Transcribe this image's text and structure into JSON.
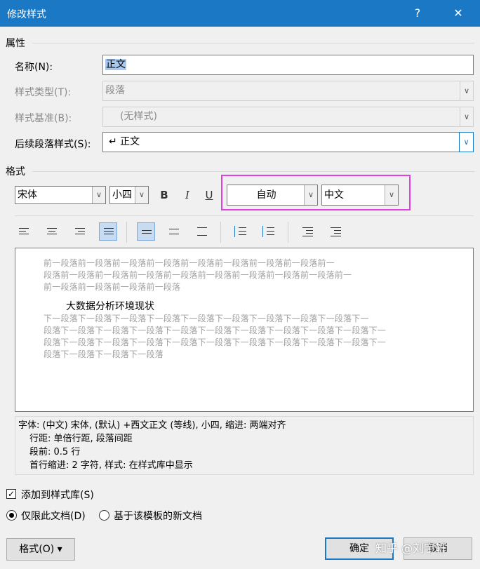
{
  "window": {
    "title": "修改样式",
    "help_glyph": "?",
    "close_glyph": "✕"
  },
  "properties": {
    "section_label": "属性",
    "name_label": "名称(N):",
    "name_value": "正文",
    "style_type_label": "样式类型(T):",
    "style_type_value": "段落",
    "style_based_label": "样式基准(B):",
    "style_based_value": "(无样式)",
    "next_style_label": "后续段落样式(S):",
    "next_style_value": "↵ 正文"
  },
  "format": {
    "section_label": "格式",
    "font": "宋体",
    "size": "小四",
    "bold": "B",
    "italic": "I",
    "underline": "U",
    "color": "自动",
    "language": "中文"
  },
  "preview": {
    "prev_lines": [
      "前一段落前一段落前一段落前一段落前一段落前一段落前一段落前一段落前一",
      "段落前一段落前一段落前一段落前一段落前一段落前一段落前一段落前一段落前一",
      "前一段落前一段落前一段落前一段落"
    ],
    "main_text": "大数据分析环境现状",
    "next_lines": [
      "下一段落下一段落下一段落下一段落下一段落下一段落下一段落下一段落下一段落下一",
      "段落下一段落下一段落下一段落下一段落下一段落下一段落下一段落下一段落下一段落下一",
      "段落下一段落下一段落下一段落下一段落下一段落下一段落下一段落下一段落下一段落下一",
      "段落下一段落下一段落下一段落"
    ]
  },
  "description": {
    "line1": "字体: (中文) 宋体, (默认) +西文正文 (等线), 小四, 缩进: 两端对齐",
    "line2": "行距: 单倍行距, 段落间距",
    "line3": "段前: 0.5 行",
    "line4": "首行缩进: 2 字符, 样式: 在样式库中显示"
  },
  "options": {
    "add_to_gallery": "添加到样式库(S)",
    "add_to_gallery_checked": true,
    "only_this_doc": "仅限此文档(D)",
    "new_docs_template": "基于该模板的新文档"
  },
  "buttons": {
    "format": "格式(O) ▾",
    "ok": "确定",
    "cancel": "取消"
  },
  "watermark": "知乎 @刘宇轩"
}
